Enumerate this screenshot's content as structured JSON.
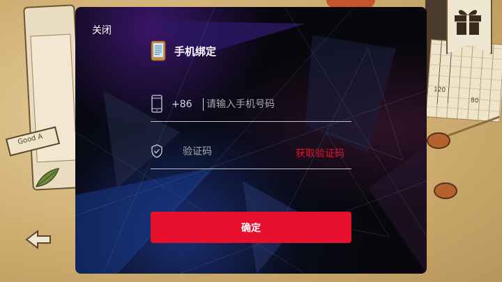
{
  "modal": {
    "close_label": "关闭",
    "title": "手机绑定",
    "phone": {
      "prefix": "+86",
      "placeholder": "请输入手机号码",
      "value": ""
    },
    "code": {
      "placeholder": "验证码",
      "value": "",
      "get_code_label": "获取验证码"
    },
    "confirm_label": "确定"
  },
  "background": {
    "sign_text": "Good A",
    "map_labels": [
      "120",
      "80"
    ]
  },
  "colors": {
    "accent": "#e8112d",
    "modal_bg": "#07070c",
    "divider": "#bfbfc4",
    "text": "#ffffff"
  },
  "icons": {
    "title": "phone-document-icon",
    "phone_field": "smartphone-icon",
    "code_field": "shield-check-icon",
    "gift": "gift-icon"
  }
}
